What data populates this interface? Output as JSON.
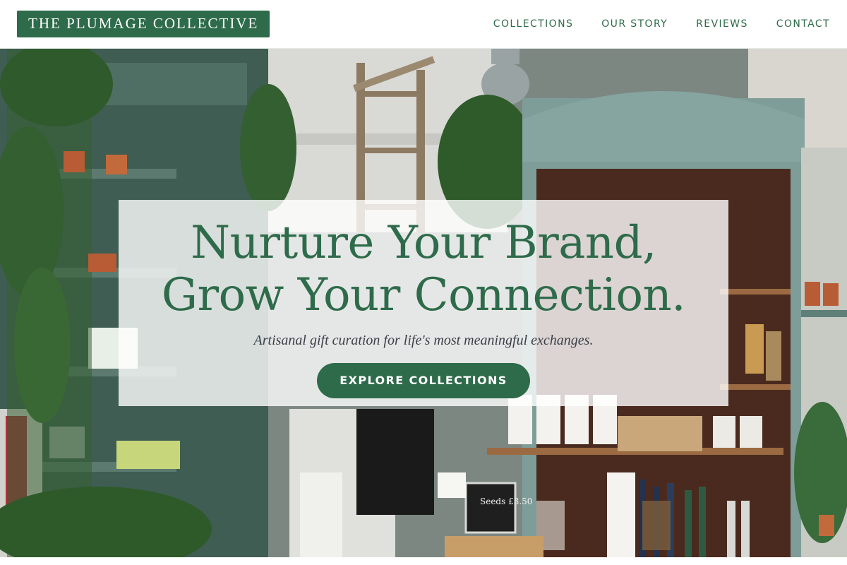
{
  "header": {
    "logo_text": "THE PLUMAGE COLLECTIVE",
    "nav": [
      {
        "label": "COLLECTIONS"
      },
      {
        "label": "OUR STORY"
      },
      {
        "label": "REVIEWS"
      },
      {
        "label": "CONTACT"
      }
    ]
  },
  "hero": {
    "headline_line1": "Nurture Your Brand,",
    "headline_line2": "Grow Your Connection.",
    "tagline": "Artisanal gift curation for life's most meaningful exchanges.",
    "cta_label": "EXPLORE COLLECTIONS",
    "sign_text": "Seeds £3.50"
  },
  "colors": {
    "brand_green": "#2e6b4a",
    "card_overlay": "rgba(255,255,255,0.80)",
    "tagline_text": "#3a3f48"
  }
}
